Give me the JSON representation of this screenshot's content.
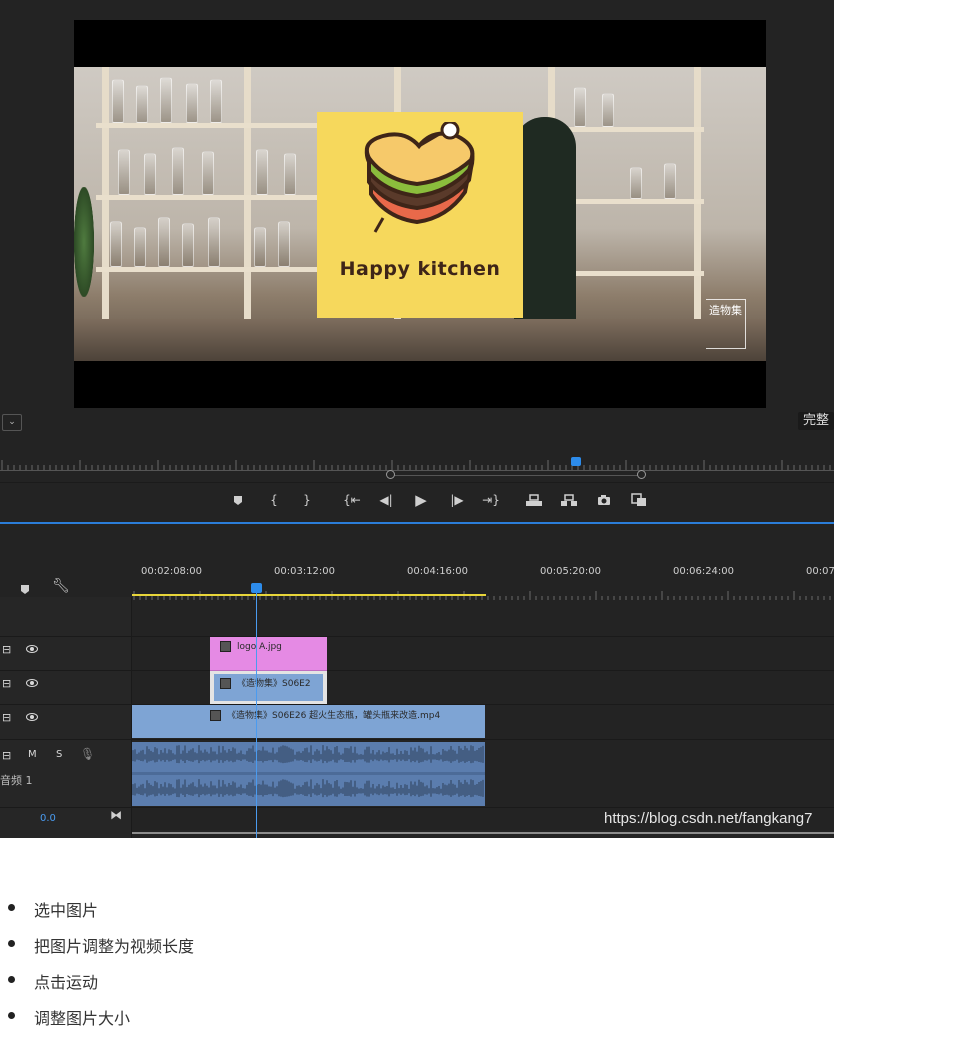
{
  "monitor": {
    "logo_text": "Happy kitchen",
    "watermark_text": "造物集",
    "quality_label": "完整"
  },
  "transport": {
    "icons": [
      "marker-icon",
      "in-point-icon",
      "out-point-icon",
      "go-to-in-icon",
      "step-back-icon",
      "play-icon",
      "step-forward-icon",
      "go-to-out-icon",
      "lift-icon",
      "extract-icon",
      "export-frame-icon",
      "compare-icon"
    ]
  },
  "timeline": {
    "timecodes": [
      "00:02:08:00",
      "00:03:12:00",
      "00:04:16:00",
      "00:05:20:00",
      "00:06:24:00",
      "00:07"
    ],
    "tracks": {
      "v3_clip": "logo A.jpg",
      "v2_clip": "《造物集》S06E2",
      "v1_clip": "《造物集》S06E26 超火生态瓶，罐头瓶来改造.mp4",
      "audio_label": "音频 1",
      "audio_m": "M",
      "audio_s": "S",
      "volume": "0.0"
    },
    "url": "https://blog.csdn.net/fangkang7"
  },
  "colors": {
    "playhead": "#2d8ceb",
    "v3_clip": "#e58ae4",
    "video_clip": "#7ea4d4",
    "audio_clip": "#5b7dae",
    "work_area": "#e8d53a"
  },
  "bullets": [
    "选中图片",
    "把图片调整为视频长度",
    "点击运动",
    "调整图片大小"
  ]
}
